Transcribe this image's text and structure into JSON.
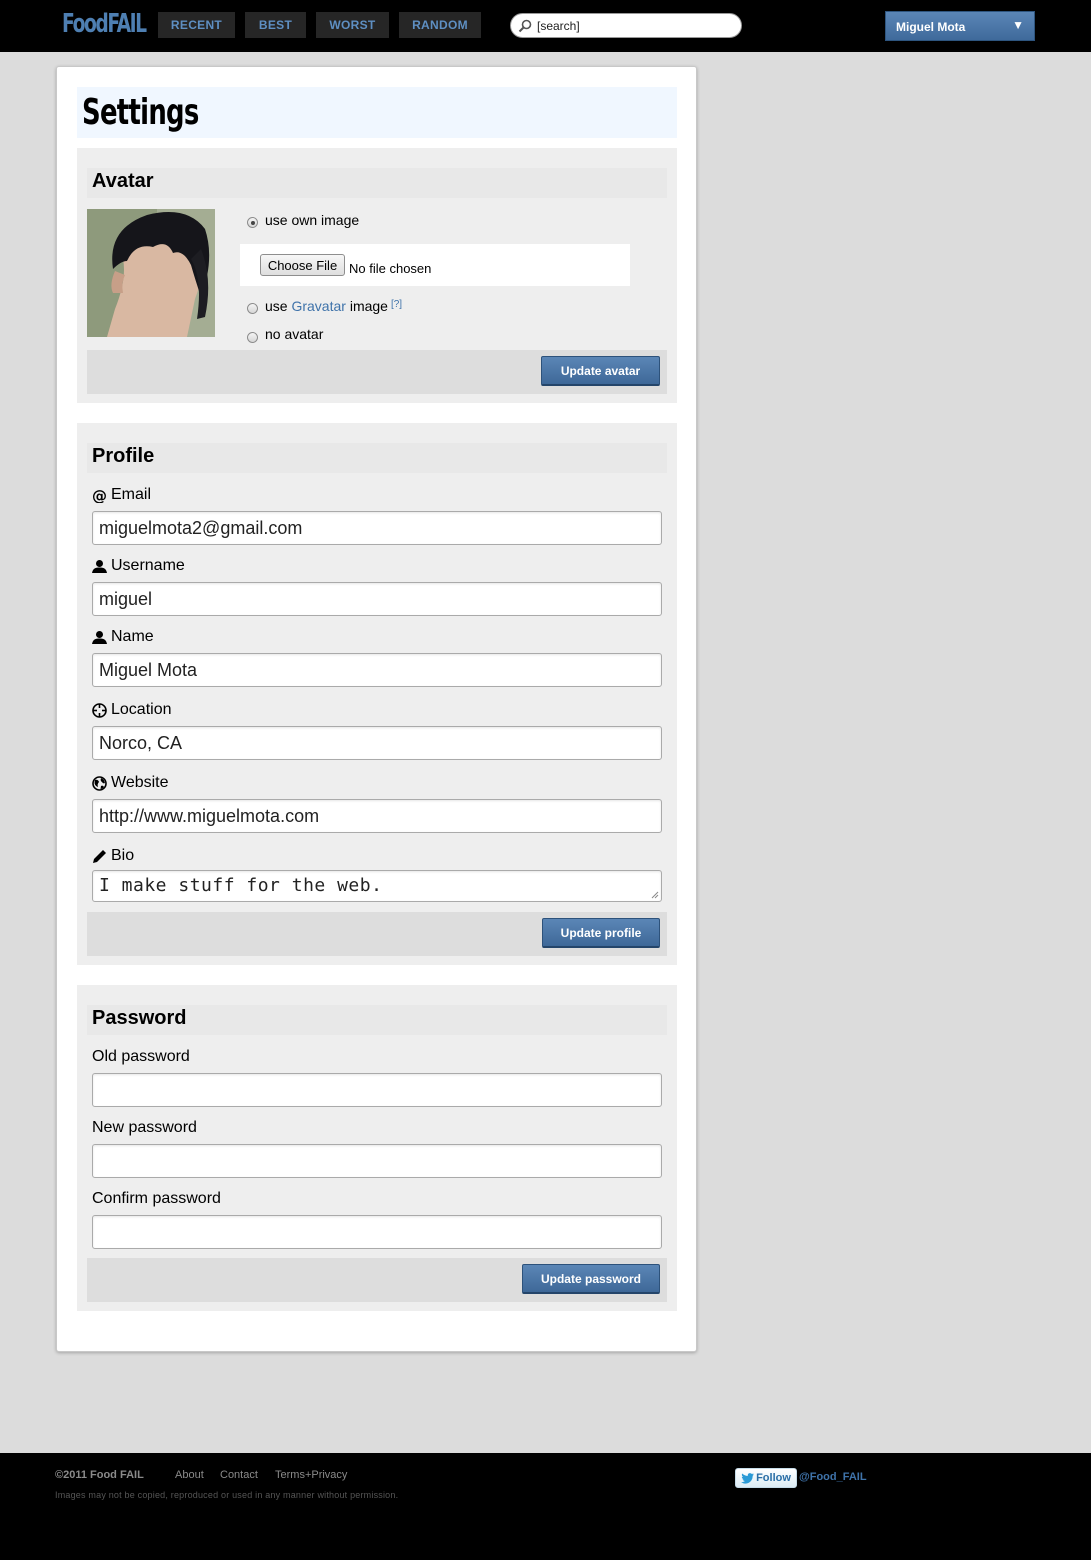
{
  "header": {
    "logo_food": "Food",
    "logo_fail": "FAIL",
    "nav": [
      "RECENT",
      "BEST",
      "WORST",
      "RANDOM"
    ],
    "search_value": "[search]",
    "user_name": "Miguel Mota",
    "user_chevron": "▼"
  },
  "page_title": "Settings",
  "avatar": {
    "heading": "Avatar",
    "option_own": "use own image",
    "choose_file": "Choose File",
    "no_file": "No file chosen",
    "option_gravatar_pre": "use ",
    "option_gravatar_link": "Gravatar",
    "option_gravatar_post": " image",
    "option_gravatar_help": "[?]",
    "option_none": "no avatar",
    "selected": "own",
    "submit": "Update avatar"
  },
  "profile": {
    "heading": "Profile",
    "email_label": "Email",
    "email_value": "miguelmota2@gmail.com",
    "username_label": "Username",
    "username_value": "miguel",
    "name_label": "Name",
    "name_value": "Miguel Mota",
    "location_label": "Location",
    "location_value": "Norco, CA",
    "website_label": "Website",
    "website_value": "http://www.miguelmota.com",
    "bio_label": "Bio",
    "bio_value": "I make stuff for the web.",
    "submit": "Update profile"
  },
  "password": {
    "heading": "Password",
    "old_label": "Old password",
    "new_label": "New password",
    "confirm_label": "Confirm password",
    "submit": "Update password"
  },
  "footer": {
    "copyright": "©2011 Food FAIL",
    "links": [
      "About",
      "Contact",
      "Terms+Privacy"
    ],
    "disclaimer": "Images may not be copied, reproduced or used in any manner without permission.",
    "follow": "Follow",
    "handle": "@Food_FAIL"
  },
  "colors": {
    "accent": "#4e7fb2",
    "button": "#4a75a6",
    "background": "#dcdcdc"
  }
}
